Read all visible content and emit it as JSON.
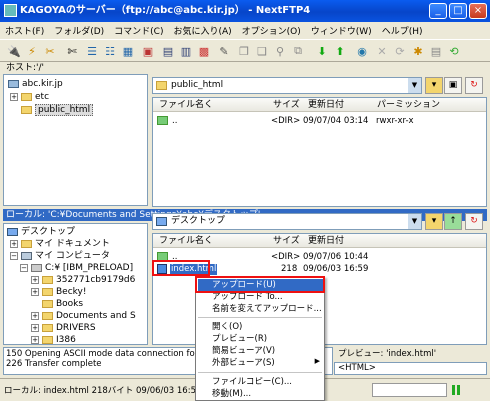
{
  "window": {
    "title": "KAGOYAのサーバー（ftp://abc@abc.kir.jp） - NextFTP4"
  },
  "menu": [
    "ホスト(F)",
    "フォルダ(D)",
    "コマンド(C)",
    "お気に入り(A)",
    "オプション(O)",
    "ウィンドウ(W)",
    "ヘルプ(H)"
  ],
  "host_label": "ホスト:'/'",
  "remote": {
    "tree": [
      "abc.kir.jp",
      "etc",
      "public_html"
    ],
    "path": "public_html",
    "columns": [
      "ファイル名く",
      "サイズ",
      "更新日付",
      "パーミッション"
    ],
    "files": [
      {
        "name": "..",
        "size": "<DIR>",
        "date": "09/07/04 03:14",
        "perm": "rwxr-xr-x"
      }
    ]
  },
  "local": {
    "bar": "ローカル: 'C:¥Documents and Settings¥abc¥デスクトップ'",
    "tree": [
      "デスクトップ",
      "マイ ドキュメント",
      "マイ コンピュータ",
      "C:¥ [IBM_PRELOAD]",
      "352771cb9179d6",
      "Becky!",
      "Books",
      "Documents and S",
      "DRIVERS",
      "I386"
    ],
    "path": "デスクトップ",
    "columns": [
      "ファイル名く",
      "サイズ",
      "更新日付"
    ],
    "files": [
      {
        "name": "..",
        "size": "<DIR>",
        "date": "09/07/06 10:44"
      },
      {
        "name": "index.html",
        "size": "218",
        "date": "09/06/03 16:59"
      }
    ]
  },
  "context_menu": [
    "アップロード(U)",
    "アップロード To...",
    "名前を変えてアップロード...",
    "開く(O)",
    "プレビュー(R)",
    "簡易ビューア(V)",
    "外部ビューア(S)",
    "ファイルコピー(C)...",
    "移動(M)..."
  ],
  "log": [
    "150 Opening ASCII mode data connection for file",
    "226 Transfer complete"
  ],
  "preview": {
    "label": "プレビュー: 'index.html'",
    "value": "<HTML>"
  },
  "status": {
    "text": "ローカル: index.html  218バイト  09/06/03 16:59"
  },
  "colors": {
    "title": "#0a5cf0",
    "highlight": "#316ac5",
    "red": "#e11111"
  },
  "icons": [
    "connect-icon",
    "disconnect-icon",
    "upload-icon",
    "download-icon",
    "sync-icon",
    "delete-icon"
  ]
}
